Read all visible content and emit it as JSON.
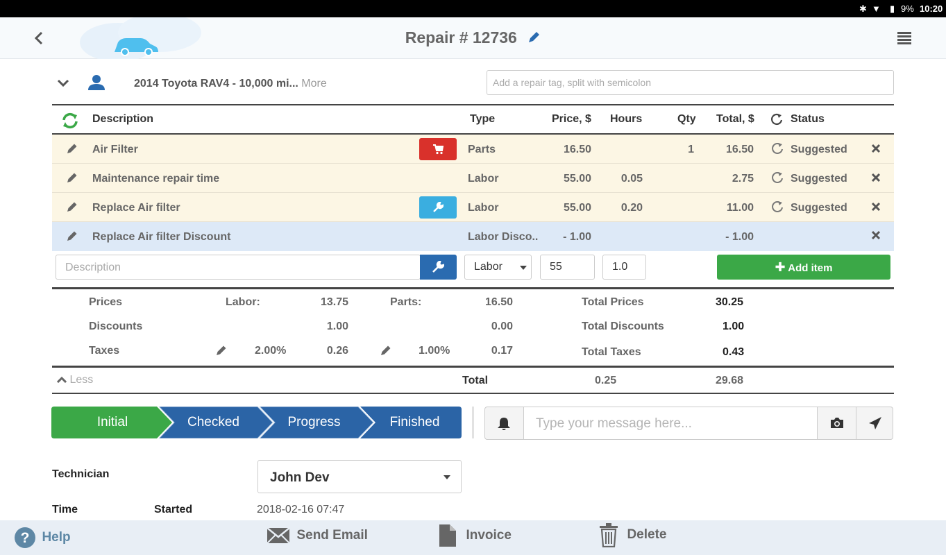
{
  "statusbar": {
    "battery": "9%",
    "time": "10:20"
  },
  "header": {
    "title": "Repair # 12736"
  },
  "vehicle": {
    "name": "2014 Toyota RAV4  - 10,000 mi...",
    "more": "More",
    "tag_placeholder": "Add a repair tag, split with semicolon"
  },
  "table": {
    "columns": {
      "description": "Description",
      "type": "Type",
      "price": "Price, $",
      "hours": "Hours",
      "qty": "Qty",
      "total": "Total, $",
      "status": "Status"
    },
    "rows": [
      {
        "description": "Air Filter",
        "type": "Parts",
        "price": "16.50",
        "hours": "",
        "qty": "1",
        "total": "16.50",
        "status": "Suggested"
      },
      {
        "description": "Maintenance repair time",
        "type": "Labor",
        "price": "55.00",
        "hours": "0.05",
        "qty": "",
        "total": "2.75",
        "status": "Suggested"
      },
      {
        "description": "Replace Air filter",
        "type": "Labor",
        "price": "55.00",
        "hours": "0.20",
        "qty": "",
        "total": "11.00",
        "status": "Suggested"
      },
      {
        "description": "Replace Air filter Discount",
        "type": "Labor Disco..",
        "price": "- 1.00",
        "hours": "",
        "qty": "",
        "total": "- 1.00",
        "status": ""
      }
    ]
  },
  "add_form": {
    "description_placeholder": "Description",
    "type": "Labor",
    "price": "55",
    "hours": "1.0",
    "add_label": "Add item"
  },
  "summary": {
    "prices_label": "Prices",
    "labor_label": "Labor:",
    "labor_price": "13.75",
    "parts_label": "Parts:",
    "parts_price": "16.50",
    "total_prices_label": "Total Prices",
    "total_prices": "30.25",
    "discounts_label": "Discounts",
    "labor_discount": "1.00",
    "parts_discount": "0.00",
    "total_discounts_label": "Total Discounts",
    "total_discounts": "1.00",
    "taxes_label": "Taxes",
    "labor_tax_rate": "2.00%",
    "labor_tax": "0.26",
    "parts_tax_rate": "1.00%",
    "parts_tax": "0.17",
    "total_taxes_label": "Total Taxes",
    "total_taxes": "0.43",
    "less_label": "Less",
    "total_label": "Total",
    "total_hours": "0.25",
    "grand_total": "29.68"
  },
  "workflow": {
    "steps": [
      "Initial",
      "Checked",
      "Progress",
      "Finished"
    ]
  },
  "message": {
    "placeholder": "Type your message here..."
  },
  "details": {
    "technician_label": "Technician",
    "technician": "John Dev",
    "time_label": "Time",
    "started_label": "Started",
    "started": "2018-02-16 07:47"
  },
  "footer": {
    "help": "Help",
    "send_email": "Send Email",
    "invoice": "Invoice",
    "delete": "Delete"
  },
  "colors": {
    "accent_blue": "#2a6bb0",
    "green": "#3ba847",
    "red": "#d9312b",
    "cyan": "#3aaee0",
    "row_yellow": "#fcf6e4",
    "row_blue": "#dde9f7"
  }
}
